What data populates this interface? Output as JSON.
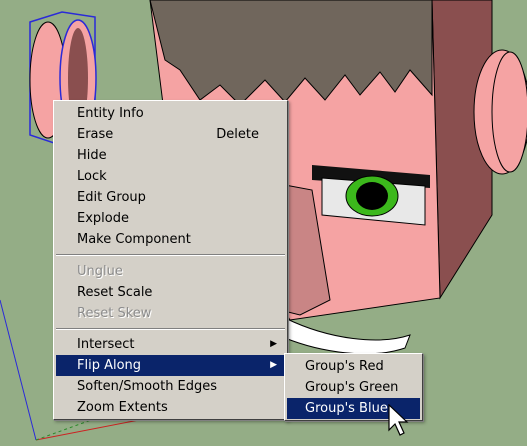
{
  "context_menu": {
    "items": [
      {
        "label": "Entity Info"
      },
      {
        "label": "Erase",
        "shortcut": "Delete"
      },
      {
        "label": "Hide"
      },
      {
        "label": "Lock"
      },
      {
        "label": "Edit Group"
      },
      {
        "label": "Explode"
      },
      {
        "label": "Make Component"
      },
      {
        "label": "Unglue",
        "disabled": true
      },
      {
        "label": "Reset Scale"
      },
      {
        "label": "Reset Skew",
        "disabled": true
      },
      {
        "label": "Intersect",
        "submenu": true
      },
      {
        "label": "Flip Along",
        "submenu": true,
        "highlighted": true
      },
      {
        "label": "Soften/Smooth Edges"
      },
      {
        "label": "Zoom Extents"
      }
    ]
  },
  "submenu": {
    "items": [
      {
        "label": "Group's Red"
      },
      {
        "label": "Group's Green"
      },
      {
        "label": "Group's Blue",
        "highlighted": true
      }
    ]
  },
  "colors": {
    "background": "#94ad86",
    "skin": "#f5a3a3",
    "skin_shadow": "#8a4f4f",
    "hair": "#70665c",
    "eye": "#3cb81c",
    "menu_face": "#d4d0c8",
    "highlight": "#0a246a"
  }
}
